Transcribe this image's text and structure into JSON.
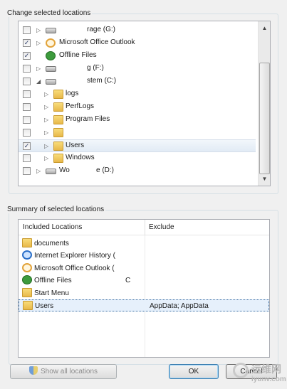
{
  "change_group": {
    "title": "Change selected locations"
  },
  "tree": {
    "items": [
      {
        "label": "rage (G:)",
        "checked": false,
        "icon": "drive-icon"
      },
      {
        "label": "Microsoft Office Outlook",
        "checked": true,
        "icon": "outlook-icon"
      },
      {
        "label": "Offline Files",
        "checked": true,
        "icon": "offline-files-icon"
      },
      {
        "label": "g (F:)",
        "checked": false,
        "icon": "drive-icon"
      },
      {
        "label": "stem (C:)",
        "checked": false,
        "icon": "windows-drive-icon"
      },
      {
        "label": "logs",
        "checked": false,
        "icon": "folder-icon"
      },
      {
        "label": "PerfLogs",
        "checked": false,
        "icon": "folder-icon"
      },
      {
        "label": "Program Files",
        "checked": false,
        "icon": "folder-icon"
      },
      {
        "label": "",
        "checked": false,
        "icon": "folder-icon"
      },
      {
        "label": "Users",
        "checked": true,
        "icon": "folder-icon",
        "selected": true
      },
      {
        "label": "Windows",
        "checked": false,
        "icon": "folder-icon"
      },
      {
        "label": "Wo",
        "label_tail": "e (D:)",
        "checked": false,
        "icon": "drive-icon"
      }
    ]
  },
  "summary_group": {
    "title": "Summary of selected locations"
  },
  "summary": {
    "columns": {
      "included": "Included Locations",
      "exclude": "Exclude"
    },
    "rows": [
      {
        "label": "documents",
        "exclude": "",
        "icon": "folder-icon"
      },
      {
        "label": "Internet Explorer History (",
        "exclude": "",
        "icon": "internet-explorer-icon"
      },
      {
        "label": "Microsoft Office Outlook (",
        "exclude": "",
        "icon": "outlook-icon"
      },
      {
        "label": "Offline Files",
        "label_tail": "C",
        "exclude": "",
        "icon": "offline-files-icon"
      },
      {
        "label": "Start Menu",
        "exclude": "",
        "icon": "folder-icon"
      },
      {
        "label": "Users",
        "exclude": "AppData; AppData",
        "icon": "folder-icon",
        "selected": true
      }
    ]
  },
  "buttons": {
    "show_all": "Show all locations",
    "ok": "OK",
    "cancel": "Cancel"
  },
  "watermark": {
    "cn": "运维网",
    "en": "iyunv.com"
  }
}
